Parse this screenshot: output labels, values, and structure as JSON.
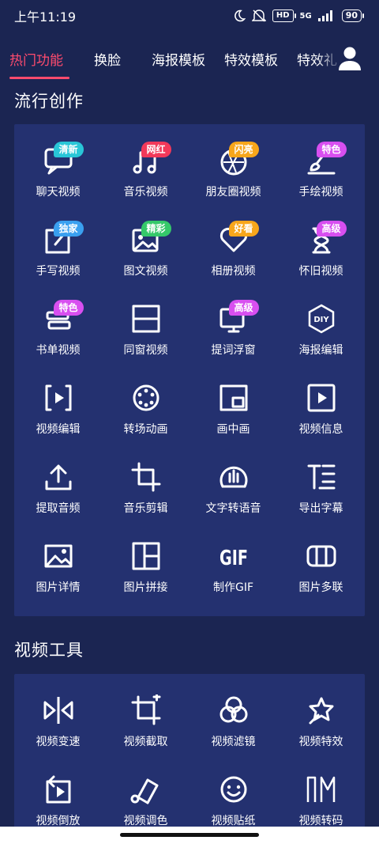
{
  "status": {
    "time": "上午11:19",
    "network": "5G",
    "hd": "HD",
    "battery": "90"
  },
  "tabs": [
    {
      "label": "热门功能",
      "active": true
    },
    {
      "label": "换脸",
      "active": false
    },
    {
      "label": "海报模板",
      "active": false
    },
    {
      "label": "特效模板",
      "active": false
    },
    {
      "label": "特效礼",
      "active": false
    }
  ],
  "sections": {
    "popular": {
      "title": "流行创作",
      "items": [
        {
          "label": "聊天视频",
          "icon": "chat-icon",
          "badge": "清新",
          "badge_color": "#29c6d7"
        },
        {
          "label": "音乐视频",
          "icon": "music-icon",
          "badge": "网红",
          "badge_color": "#f2395a"
        },
        {
          "label": "朋友圈视频",
          "icon": "aperture-icon",
          "badge": "闪亮",
          "badge_color": "#f8a61b"
        },
        {
          "label": "手绘视频",
          "icon": "brush-icon",
          "badge": "特色",
          "badge_color": "#d84ff0"
        },
        {
          "label": "手写视频",
          "icon": "handwrite-icon",
          "badge": "独家",
          "badge_color": "#3aa0f0"
        },
        {
          "label": "图文视频",
          "icon": "image-text-icon",
          "badge": "精彩",
          "badge_color": "#35c86a"
        },
        {
          "label": "相册视频",
          "icon": "heart-icon",
          "badge": "好看",
          "badge_color": "#f8a61b"
        },
        {
          "label": "怀旧视频",
          "icon": "hourglass-icon",
          "badge": "高级",
          "badge_color": "#d84ff0"
        },
        {
          "label": "书单视频",
          "icon": "book-icon",
          "badge": "特色",
          "badge_color": "#d84ff0"
        },
        {
          "label": "同窗视频",
          "icon": "split-window-icon",
          "badge": "",
          "badge_color": ""
        },
        {
          "label": "提词浮窗",
          "icon": "teleprompter-icon",
          "badge": "高级",
          "badge_color": "#d84ff0"
        },
        {
          "label": "海报编辑",
          "icon": "diy-icon",
          "badge": "",
          "badge_color": ""
        },
        {
          "label": "视频编辑",
          "icon": "video-edit-icon",
          "badge": "",
          "badge_color": ""
        },
        {
          "label": "转场动画",
          "icon": "transition-icon",
          "badge": "",
          "badge_color": ""
        },
        {
          "label": "画中画",
          "icon": "pip-icon",
          "badge": "",
          "badge_color": ""
        },
        {
          "label": "视频信息",
          "icon": "video-info-icon",
          "badge": "",
          "badge_color": ""
        },
        {
          "label": "提取音频",
          "icon": "upload-icon",
          "badge": "",
          "badge_color": ""
        },
        {
          "label": "音乐剪辑",
          "icon": "crop-icon",
          "badge": "",
          "badge_color": ""
        },
        {
          "label": "文字转语音",
          "icon": "voice-icon",
          "badge": "",
          "badge_color": ""
        },
        {
          "label": "导出字幕",
          "icon": "subtitle-icon",
          "badge": "",
          "badge_color": ""
        },
        {
          "label": "图片详情",
          "icon": "image-icon",
          "badge": "",
          "badge_color": ""
        },
        {
          "label": "图片拼接",
          "icon": "collage-icon",
          "badge": "",
          "badge_color": ""
        },
        {
          "label": "制作GIF",
          "icon": "gif-icon",
          "badge": "",
          "badge_color": ""
        },
        {
          "label": "图片多联",
          "icon": "multi-panel-icon",
          "badge": "",
          "badge_color": ""
        }
      ]
    },
    "video_tools": {
      "title": "视频工具",
      "items": [
        {
          "label": "视频变速",
          "icon": "speed-icon"
        },
        {
          "label": "视频截取",
          "icon": "trim-icon"
        },
        {
          "label": "视频滤镜",
          "icon": "filter-icon"
        },
        {
          "label": "视频特效",
          "icon": "effect-icon"
        },
        {
          "label": "视频倒放",
          "icon": "reverse-icon"
        },
        {
          "label": "视频调色",
          "icon": "color-icon"
        },
        {
          "label": "视频贴纸",
          "icon": "sticker-icon"
        },
        {
          "label": "视频转码",
          "icon": "transcode-icon"
        }
      ]
    }
  },
  "icon_text": {
    "diy": "DIY",
    "gif": "GIF"
  },
  "colors": {
    "background": "#1b2552",
    "panel": "#243170",
    "accent": "#ff4b6e"
  }
}
